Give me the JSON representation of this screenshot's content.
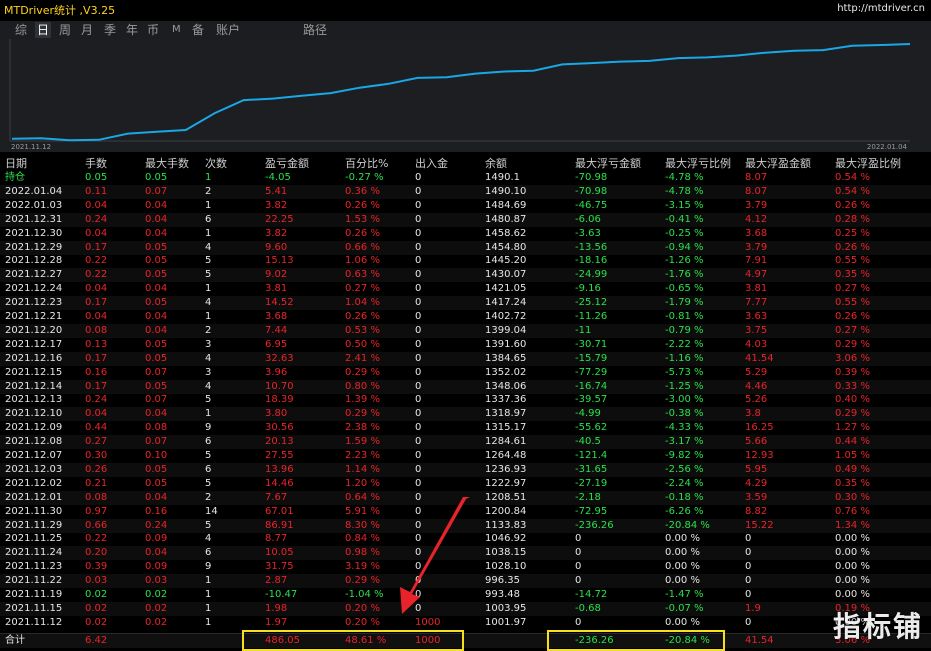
{
  "window": {
    "title": "MTDriver统计 ,V3.25",
    "url": "http://mtdriver.cn"
  },
  "menu": {
    "items": [
      "综",
      "日",
      "周",
      "月",
      "季",
      "年",
      "币",
      "M",
      "备",
      "账户",
      "路径"
    ],
    "active_index": 1
  },
  "chart": {
    "x_start_label": "2021.11.12",
    "x_end_label": "2022.01.04",
    "line_color": "#1aa7e6"
  },
  "chart_data": {
    "type": "line",
    "x": [
      "2021.11.12",
      "2021.11.15",
      "2021.11.19",
      "2021.11.22",
      "2021.11.23",
      "2021.11.24",
      "2021.11.25",
      "2021.11.29",
      "2021.11.30",
      "2021.12.01",
      "2021.12.02",
      "2021.12.03",
      "2021.12.07",
      "2021.12.08",
      "2021.12.09",
      "2021.12.10",
      "2021.12.13",
      "2021.12.14",
      "2021.12.15",
      "2021.12.16",
      "2021.12.17",
      "2021.12.20",
      "2021.12.21",
      "2021.12.23",
      "2021.12.24",
      "2021.12.27",
      "2021.12.28",
      "2021.12.29",
      "2021.12.30",
      "2021.12.31",
      "2022.01.03",
      "2022.01.04"
    ],
    "series": [
      {
        "values": [
          1001.97,
          1003.95,
          993.48,
          996.35,
          1028.1,
          1038.15,
          1046.92,
          1133.83,
          1200.84,
          1208.51,
          1222.97,
          1236.93,
          1264.48,
          1284.61,
          1315.17,
          1318.97,
          1337.36,
          1348.06,
          1352.02,
          1384.65,
          1391.6,
          1399.04,
          1402.72,
          1417.24,
          1421.05,
          1430.07,
          1445.2,
          1454.8,
          1458.62,
          1480.87,
          1484.69,
          1490.1
        ]
      }
    ]
  },
  "table": {
    "headers": [
      "日期",
      "手数",
      "最大手数",
      "次数",
      "盈亏金额",
      "百分比%",
      "出入金",
      "余额",
      "最大浮亏金额",
      "最大浮亏比例",
      "最大浮盈金额",
      "最大浮盈比例"
    ],
    "rows": [
      [
        "持仓",
        "0.05",
        "0.05",
        "1",
        "-4.05",
        "-0.27 %",
        "0",
        "1490.1",
        "-70.98",
        "-4.78 %",
        "8.07",
        "0.54 %"
      ],
      [
        "2022.01.04",
        "0.11",
        "0.07",
        "2",
        "5.41",
        "0.36 %",
        "0",
        "1490.10",
        "-70.98",
        "-4.78 %",
        "8.07",
        "0.54 %"
      ],
      [
        "2022.01.03",
        "0.04",
        "0.04",
        "1",
        "3.82",
        "0.26 %",
        "0",
        "1484.69",
        "-46.75",
        "-3.15 %",
        "3.79",
        "0.26 %"
      ],
      [
        "2021.12.31",
        "0.24",
        "0.04",
        "6",
        "22.25",
        "1.53 %",
        "0",
        "1480.87",
        "-6.06",
        "-0.41 %",
        "4.12",
        "0.28 %"
      ],
      [
        "2021.12.30",
        "0.04",
        "0.04",
        "1",
        "3.82",
        "0.26 %",
        "0",
        "1458.62",
        "-3.63",
        "-0.25 %",
        "3.68",
        "0.25 %"
      ],
      [
        "2021.12.29",
        "0.17",
        "0.05",
        "4",
        "9.60",
        "0.66 %",
        "0",
        "1454.80",
        "-13.56",
        "-0.94 %",
        "3.79",
        "0.26 %"
      ],
      [
        "2021.12.28",
        "0.22",
        "0.05",
        "5",
        "15.13",
        "1.06 %",
        "0",
        "1445.20",
        "-18.16",
        "-1.26 %",
        "7.91",
        "0.55 %"
      ],
      [
        "2021.12.27",
        "0.22",
        "0.05",
        "5",
        "9.02",
        "0.63 %",
        "0",
        "1430.07",
        "-24.99",
        "-1.76 %",
        "4.97",
        "0.35 %"
      ],
      [
        "2021.12.24",
        "0.04",
        "0.04",
        "1",
        "3.81",
        "0.27 %",
        "0",
        "1421.05",
        "-9.16",
        "-0.65 %",
        "3.81",
        "0.27 %"
      ],
      [
        "2021.12.23",
        "0.17",
        "0.05",
        "4",
        "14.52",
        "1.04 %",
        "0",
        "1417.24",
        "-25.12",
        "-1.79 %",
        "7.77",
        "0.55 %"
      ],
      [
        "2021.12.21",
        "0.04",
        "0.04",
        "1",
        "3.68",
        "0.26 %",
        "0",
        "1402.72",
        "-11.26",
        "-0.81 %",
        "3.63",
        "0.26 %"
      ],
      [
        "2021.12.20",
        "0.08",
        "0.04",
        "2",
        "7.44",
        "0.53 %",
        "0",
        "1399.04",
        "-11",
        "-0.79 %",
        "3.75",
        "0.27 %"
      ],
      [
        "2021.12.17",
        "0.13",
        "0.05",
        "3",
        "6.95",
        "0.50 %",
        "0",
        "1391.60",
        "-30.71",
        "-2.22 %",
        "4.03",
        "0.29 %"
      ],
      [
        "2021.12.16",
        "0.17",
        "0.05",
        "4",
        "32.63",
        "2.41 %",
        "0",
        "1384.65",
        "-15.79",
        "-1.16 %",
        "41.54",
        "3.06 %"
      ],
      [
        "2021.12.15",
        "0.16",
        "0.07",
        "3",
        "3.96",
        "0.29 %",
        "0",
        "1352.02",
        "-77.29",
        "-5.73 %",
        "5.29",
        "0.39 %"
      ],
      [
        "2021.12.14",
        "0.17",
        "0.05",
        "4",
        "10.70",
        "0.80 %",
        "0",
        "1348.06",
        "-16.74",
        "-1.25 %",
        "4.46",
        "0.33 %"
      ],
      [
        "2021.12.13",
        "0.24",
        "0.07",
        "5",
        "18.39",
        "1.39 %",
        "0",
        "1337.36",
        "-39.57",
        "-3.00 %",
        "5.26",
        "0.40 %"
      ],
      [
        "2021.12.10",
        "0.04",
        "0.04",
        "1",
        "3.80",
        "0.29 %",
        "0",
        "1318.97",
        "-4.99",
        "-0.38 %",
        "3.8",
        "0.29 %"
      ],
      [
        "2021.12.09",
        "0.44",
        "0.08",
        "9",
        "30.56",
        "2.38 %",
        "0",
        "1315.17",
        "-55.62",
        "-4.33 %",
        "16.25",
        "1.27 %"
      ],
      [
        "2021.12.08",
        "0.27",
        "0.07",
        "6",
        "20.13",
        "1.59 %",
        "0",
        "1284.61",
        "-40.5",
        "-3.17 %",
        "5.66",
        "0.44 %"
      ],
      [
        "2021.12.07",
        "0.30",
        "0.10",
        "5",
        "27.55",
        "2.23 %",
        "0",
        "1264.48",
        "-121.4",
        "-9.82 %",
        "12.93",
        "1.05 %"
      ],
      [
        "2021.12.03",
        "0.26",
        "0.05",
        "6",
        "13.96",
        "1.14 %",
        "0",
        "1236.93",
        "-31.65",
        "-2.56 %",
        "5.95",
        "0.49 %"
      ],
      [
        "2021.12.02",
        "0.21",
        "0.05",
        "5",
        "14.46",
        "1.20 %",
        "0",
        "1222.97",
        "-27.19",
        "-2.24 %",
        "4.29",
        "0.35 %"
      ],
      [
        "2021.12.01",
        "0.08",
        "0.04",
        "2",
        "7.67",
        "0.64 %",
        "0",
        "1208.51",
        "-2.18",
        "-0.18 %",
        "3.59",
        "0.30 %"
      ],
      [
        "2021.11.30",
        "0.97",
        "0.16",
        "14",
        "67.01",
        "5.91 %",
        "0",
        "1200.84",
        "-72.95",
        "-6.26 %",
        "8.82",
        "0.76 %"
      ],
      [
        "2021.11.29",
        "0.66",
        "0.24",
        "5",
        "86.91",
        "8.30 %",
        "0",
        "1133.83",
        "-236.26",
        "-20.84 %",
        "15.22",
        "1.34 %"
      ],
      [
        "2021.11.25",
        "0.22",
        "0.09",
        "4",
        "8.77",
        "0.84 %",
        "0",
        "1046.92",
        "0",
        "0.00 %",
        "0",
        "0.00 %"
      ],
      [
        "2021.11.24",
        "0.20",
        "0.04",
        "6",
        "10.05",
        "0.98 %",
        "0",
        "1038.15",
        "0",
        "0.00 %",
        "0",
        "0.00 %"
      ],
      [
        "2021.11.23",
        "0.39",
        "0.09",
        "9",
        "31.75",
        "3.19 %",
        "0",
        "1028.10",
        "0",
        "0.00 %",
        "0",
        "0.00 %"
      ],
      [
        "2021.11.22",
        "0.03",
        "0.03",
        "1",
        "2.87",
        "0.29 %",
        "0",
        "996.35",
        "0",
        "0.00 %",
        "0",
        "0.00 %"
      ],
      [
        "2021.11.19",
        "0.02",
        "0.02",
        "1",
        "-10.47",
        "-1.04 %",
        "0",
        "993.48",
        "-14.72",
        "-1.47 %",
        "0",
        "0.00 %"
      ],
      [
        "2021.11.15",
        "0.02",
        "0.02",
        "1",
        "1.98",
        "0.20 %",
        "0",
        "1003.95",
        "-0.68",
        "-0.07 %",
        "1.9",
        "0.19 %"
      ],
      [
        "2021.11.12",
        "0.02",
        "0.02",
        "1",
        "1.97",
        "0.20 %",
        "1000",
        "1001.97",
        "0",
        "0.00 %",
        "0",
        "0.00 %"
      ]
    ],
    "summary": [
      "合计",
      "6.42",
      "",
      "",
      "486.05",
      "48.61 %",
      "1000",
      "",
      "-236.26",
      "-20.84 %",
      "41.54",
      "3.06 %"
    ]
  },
  "annotations": {
    "highlight_color": "#f5e11a",
    "arrow_color": "#e8242a"
  },
  "watermark": "指标铺",
  "colors": {
    "background": "#000000",
    "title": "#ffd21f",
    "profit": "#e8242a",
    "loss": "#2ae04a",
    "neutral": "#e6e6e6"
  }
}
